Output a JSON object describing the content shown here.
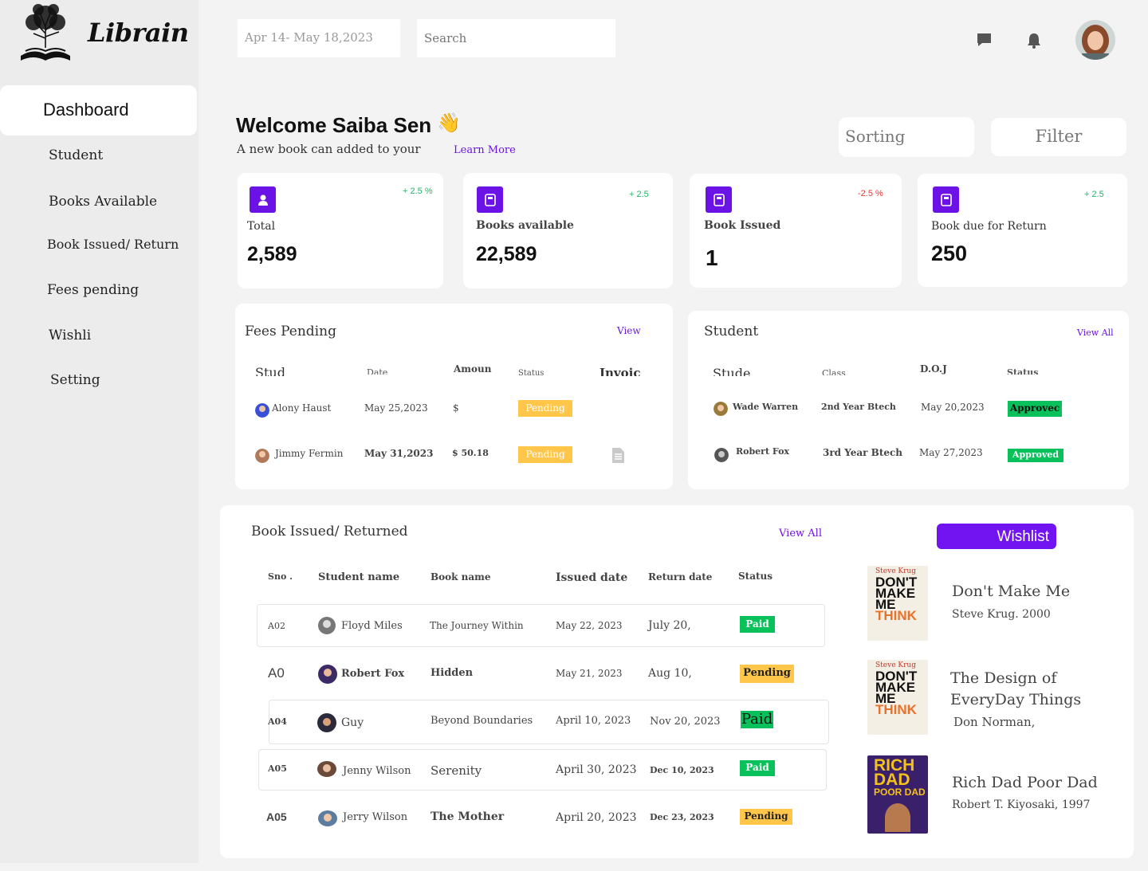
{
  "app": {
    "name": "Librain"
  },
  "sidebar": {
    "items": [
      {
        "label": "Dashboard"
      },
      {
        "label": "Student"
      },
      {
        "label": "Books Available"
      },
      {
        "label": "Book Issued/ Return"
      },
      {
        "label": "Fees pending"
      },
      {
        "label": "Wishli"
      },
      {
        "label": "Setting"
      }
    ]
  },
  "header": {
    "date_range": "Apr 14- May 18,2023",
    "search_placeholder": "Search"
  },
  "welcome": {
    "title": "Welcome Saiba Sen",
    "emoji": "👋",
    "subtitle": "A new book can added to your",
    "learn_more": "Learn More",
    "sorting": "Sorting",
    "filter": "Filter"
  },
  "stats": [
    {
      "label": "Total",
      "value": "2,589",
      "delta": "+ 2.5 %",
      "icon": "user-icon"
    },
    {
      "label": "Books available",
      "value": "22,589",
      "delta": "+ 2.5",
      "icon": "book-icon"
    },
    {
      "label": "Book Issued",
      "value": "1",
      "delta": "-2.5 %",
      "icon": "book-icon"
    },
    {
      "label": "Book due for Return",
      "value": "250",
      "delta": "+ 2.5",
      "icon": "book-icon"
    }
  ],
  "fees": {
    "title": "Fees Pending",
    "view": "View",
    "headers": [
      "Stud",
      "Date",
      "Amoun",
      "Status",
      "Invoic"
    ],
    "rows": [
      {
        "name": "Alony Haust",
        "date": "May 25,2023",
        "amount": "$",
        "status": "Pending"
      },
      {
        "name": "Jimmy Fermin",
        "date": "May 31,2023",
        "amount": "$ 50.18",
        "status": "Pending"
      }
    ]
  },
  "students": {
    "title": "Student",
    "view_all": "View All",
    "headers": [
      "Stude",
      "Class",
      "D.O.J",
      "Status"
    ],
    "rows": [
      {
        "name": "Wade Warren",
        "class": "2nd Year Btech",
        "doj": "May 20,2023",
        "status": "Approvec"
      },
      {
        "name": "Robert Fox",
        "class": "3rd Year Btech",
        "doj": "May 27,2023",
        "status": "Approved"
      }
    ]
  },
  "issued": {
    "title": "Book Issued/ Returned",
    "view_all": "View All",
    "headers": [
      "Sno .",
      "Student name",
      "Book name",
      "Issued date",
      "Return date",
      "Status"
    ],
    "rows": [
      {
        "sno": "A02",
        "name": "Floyd Miles",
        "book": "The Journey Within",
        "issued": "May 22, 2023",
        "returned": "July 20,",
        "status": "Paid"
      },
      {
        "sno": "A0",
        "name": "Robert Fox",
        "book": "Hidden",
        "issued": "May 21, 2023",
        "returned": "Aug 10,",
        "status": "Pending"
      },
      {
        "sno": "A04",
        "name": "Guy",
        "book": "Beyond Boundaries",
        "issued": "April 10, 2023",
        "returned": "Nov 20, 2023",
        "status": "Paid"
      },
      {
        "sno": "A05",
        "name": "Jenny Wilson",
        "book": "Serenity",
        "issued": "April 30, 2023",
        "returned": "Dec 10, 2023",
        "status": "Paid"
      },
      {
        "sno": "A05",
        "name": "Jerry Wilson",
        "book": "The Mother",
        "issued": "April 20, 2023",
        "returned": "Dec 23, 2023",
        "status": "Pending"
      }
    ]
  },
  "wishlist": {
    "title": "Wishlist",
    "books": [
      {
        "title": "Don't Make Me",
        "author": "Steve Krug. 2000",
        "cover_author": "Steve Krug",
        "cover_title": [
          "DON'T",
          "MAKE",
          "ME",
          "THINK"
        ]
      },
      {
        "title": "The Design of EveryDay Things",
        "author": "Don Norman,",
        "cover_author": "Steve Krug",
        "cover_title": [
          "DON'T",
          "MAKE",
          "ME",
          "THINK"
        ]
      },
      {
        "title": "Rich Dad Poor Dad",
        "author": "Robert T. Kiyosaki, 1997",
        "cover_title": [
          "RICH",
          "DAD",
          "POOR DAD"
        ]
      }
    ]
  },
  "colors": {
    "accent": "#6b13e6",
    "pending": "#ffc64a",
    "approved": "#09c15a"
  }
}
